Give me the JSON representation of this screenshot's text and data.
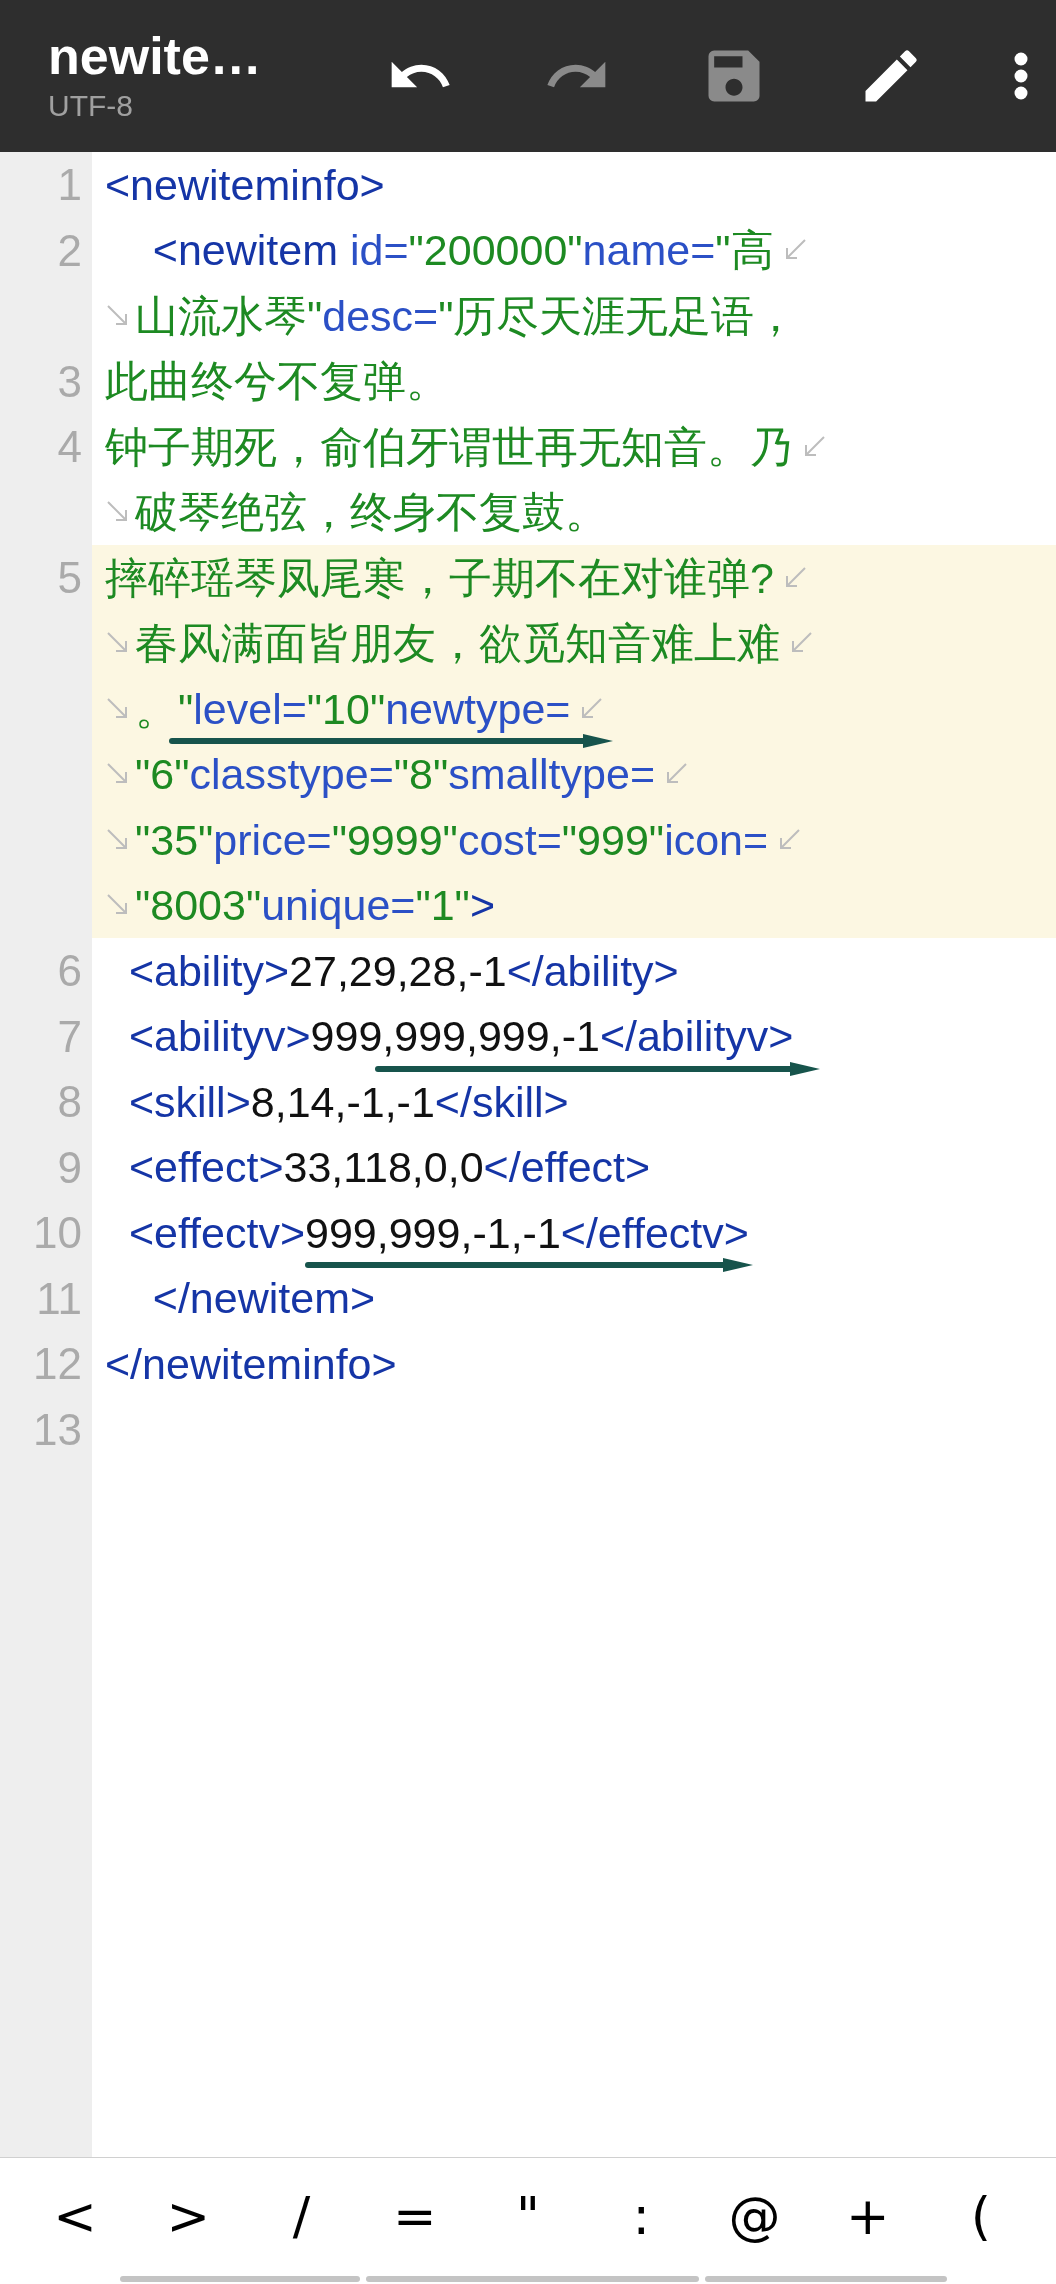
{
  "app_bar": {
    "title": "newite…",
    "encoding": "UTF-8",
    "actions": [
      {
        "kind": "undo",
        "disabled": false
      },
      {
        "kind": "redo",
        "disabled": true
      },
      {
        "kind": "save",
        "disabled": true
      },
      {
        "kind": "edit",
        "disabled": false
      },
      {
        "kind": "more",
        "disabled": false
      }
    ]
  },
  "editor": {
    "lines": [
      {
        "number": "1",
        "selected": false,
        "rows": [
          [
            {
              "kind": "tag",
              "text": "<newiteminfo>"
            }
          ]
        ]
      },
      {
        "number": "2",
        "selected": false,
        "rows": [
          [
            {
              "kind": "tag",
              "text": "    <newitem"
            },
            {
              "kind": "attr",
              "text": " id="
            },
            {
              "kind": "value",
              "text": "\"200000\""
            },
            {
              "kind": "attr",
              "text": "name="
            },
            {
              "kind": "value",
              "text": "\"高"
            }
          ],
          [
            {
              "kind": "value",
              "text": "山流水琴\""
            },
            {
              "kind": "attr",
              "text": "desc="
            },
            {
              "kind": "value",
              "text": "\"历尽天涯无足语，"
            }
          ]
        ]
      },
      {
        "number": "3",
        "selected": false,
        "rows": [
          [
            {
              "kind": "value",
              "text": "此曲终兮不复弹。"
            }
          ]
        ]
      },
      {
        "number": "4",
        "selected": false,
        "rows": [
          [
            {
              "kind": "value",
              "text": "钟子期死，俞伯牙谓世再无知音。乃"
            }
          ],
          [
            {
              "kind": "value",
              "text": "破琴绝弦，终身不复鼓。"
            }
          ]
        ]
      },
      {
        "number": "5",
        "selected": true,
        "rows": [
          [
            {
              "kind": "value",
              "text": "摔碎瑶琴凤尾寒，子期不在对谁弹?"
            }
          ],
          [
            {
              "kind": "value",
              "text": "春风满面皆朋友，欲觅知音难上难"
            }
          ],
          [
            {
              "kind": "value",
              "text": "。\""
            },
            {
              "kind": "attr",
              "text": "level="
            },
            {
              "kind": "value",
              "text": "\"10\""
            },
            {
              "kind": "attr",
              "text": "newtype="
            }
          ],
          [
            {
              "kind": "value",
              "text": "\"6\""
            },
            {
              "kind": "attr",
              "text": "classtype="
            },
            {
              "kind": "value",
              "text": "\"8\""
            },
            {
              "kind": "attr",
              "text": "smalltype="
            }
          ],
          [
            {
              "kind": "value",
              "text": "\"35\""
            },
            {
              "kind": "attr",
              "text": "price="
            },
            {
              "kind": "value",
              "text": "\"9999\""
            },
            {
              "kind": "attr",
              "text": "cost="
            },
            {
              "kind": "value",
              "text": "\"999\""
            },
            {
              "kind": "attr",
              "text": "icon="
            }
          ],
          [
            {
              "kind": "value",
              "text": "\"8003\""
            },
            {
              "kind": "attr",
              "text": "unique="
            },
            {
              "kind": "value",
              "text": "\"1\""
            },
            {
              "kind": "tag",
              "text": ">"
            }
          ]
        ]
      },
      {
        "number": "6",
        "selected": false,
        "rows": [
          [
            {
              "kind": "tag",
              "text": "  <ability>"
            },
            {
              "kind": "text",
              "text": "27,29,28,-1"
            },
            {
              "kind": "tag",
              "text": "</ability>"
            }
          ]
        ]
      },
      {
        "number": "7",
        "selected": false,
        "rows": [
          [
            {
              "kind": "tag",
              "text": "  <abilityv>"
            },
            {
              "kind": "text",
              "text": "999,999,999,-1"
            },
            {
              "kind": "tag",
              "text": "</abilityv>"
            }
          ]
        ]
      },
      {
        "number": "8",
        "selected": false,
        "rows": [
          [
            {
              "kind": "tag",
              "text": "  <skill>"
            },
            {
              "kind": "text",
              "text": "8,14,-1,-1"
            },
            {
              "kind": "tag",
              "text": "</skill>"
            }
          ]
        ]
      },
      {
        "number": "9",
        "selected": false,
        "rows": [
          [
            {
              "kind": "tag",
              "text": "  <effect>"
            },
            {
              "kind": "text",
              "text": "33,118,0,0"
            },
            {
              "kind": "tag",
              "text": "</effect>"
            }
          ]
        ]
      },
      {
        "number": "10",
        "selected": false,
        "rows": [
          [
            {
              "kind": "tag",
              "text": "  <effectv>"
            },
            {
              "kind": "text",
              "text": "999,999,-1,-1"
            },
            {
              "kind": "tag",
              "text": "</effectv>"
            }
          ]
        ]
      },
      {
        "number": "11",
        "selected": false,
        "rows": [
          [
            {
              "kind": "tag",
              "text": "    </newitem>"
            }
          ]
        ]
      },
      {
        "number": "12",
        "selected": false,
        "rows": [
          [
            {
              "kind": "tag",
              "text": "</newiteminfo>"
            }
          ]
        ]
      },
      {
        "number": "13",
        "selected": false
      }
    ]
  },
  "annotations": [
    {
      "kind": "arrow"
    },
    {
      "kind": "arrow"
    },
    {
      "kind": "arrow"
    }
  ],
  "symbol_keys": [
    "<",
    ">",
    "/",
    "=",
    "\"",
    ":",
    "@",
    "+",
    "("
  ]
}
